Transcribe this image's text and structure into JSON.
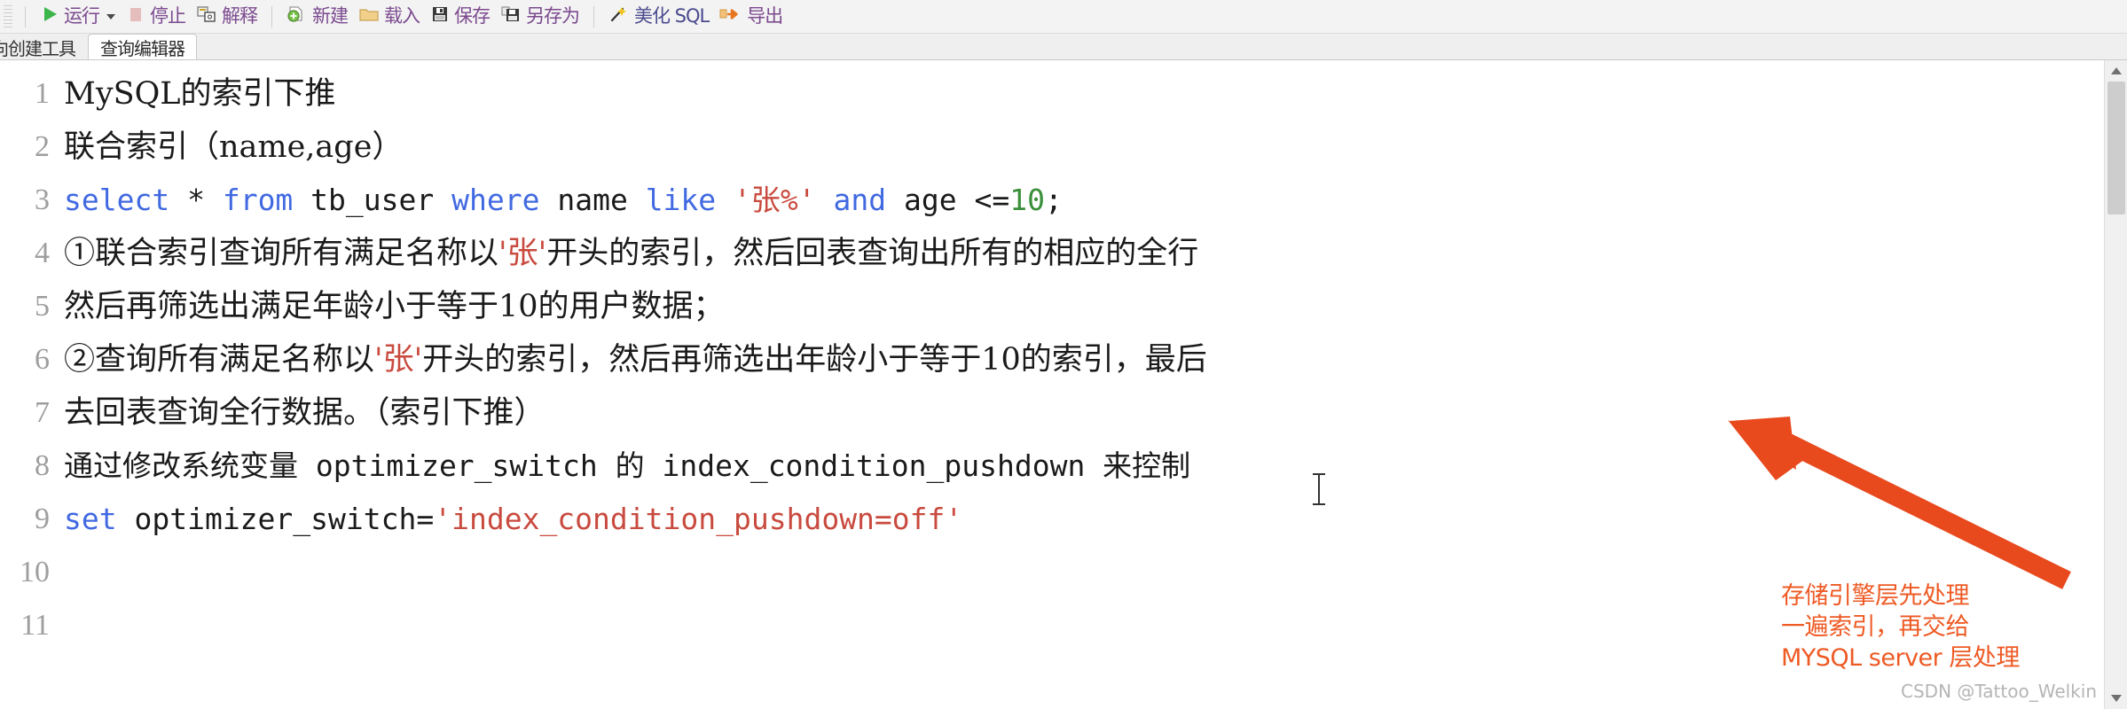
{
  "toolbar": {
    "buttons": [
      {
        "id": "run",
        "label": "运行",
        "icon": "play-icon",
        "has_caret": true
      },
      {
        "id": "stop",
        "label": "停止",
        "icon": "stop-icon",
        "has_caret": false
      },
      {
        "id": "explain",
        "label": "解释",
        "icon": "explain-icon",
        "has_caret": false
      },
      {
        "id": "new",
        "label": "新建",
        "icon": "new-file-icon",
        "has_caret": false
      },
      {
        "id": "load",
        "label": "载入",
        "icon": "folder-icon",
        "has_caret": false
      },
      {
        "id": "save",
        "label": "保存",
        "icon": "floppy-disk-icon",
        "has_caret": false
      },
      {
        "id": "save-as",
        "label": "另存为",
        "icon": "save-as-icon",
        "has_caret": false
      },
      {
        "id": "beautify",
        "label": "美化 SQL",
        "icon": "wand-icon",
        "has_caret": false
      },
      {
        "id": "export",
        "label": "导出",
        "icon": "export-arrow-icon",
        "has_caret": false
      }
    ]
  },
  "tabs": [
    {
      "id": "table-builder",
      "label": "向创建工具",
      "active": false
    },
    {
      "id": "query-editor",
      "label": "查询编辑器",
      "active": true
    }
  ],
  "editor": {
    "line_numbers": [
      "1",
      "2",
      "3",
      "4",
      "5",
      "6",
      "7",
      "8",
      "9",
      "10",
      "11"
    ],
    "lines": [
      {
        "n": 1,
        "mono": false,
        "tokens": [
          {
            "t": "MySQL的索引下推",
            "c": "plain"
          }
        ]
      },
      {
        "n": 2,
        "mono": false,
        "tokens": [
          {
            "t": "联合索引（name,age）",
            "c": "plain"
          }
        ]
      },
      {
        "n": 3,
        "mono": true,
        "tokens": [
          {
            "t": "select",
            "c": "kw"
          },
          {
            "t": " * ",
            "c": "plain"
          },
          {
            "t": "from",
            "c": "kw"
          },
          {
            "t": " tb_user ",
            "c": "plain"
          },
          {
            "t": "where",
            "c": "kw"
          },
          {
            "t": " name ",
            "c": "plain"
          },
          {
            "t": "like",
            "c": "kw"
          },
          {
            "t": " ",
            "c": "plain"
          },
          {
            "t": "'张%'",
            "c": "str"
          },
          {
            "t": " ",
            "c": "plain"
          },
          {
            "t": "and",
            "c": "kw"
          },
          {
            "t": " age <=",
            "c": "plain"
          },
          {
            "t": "10",
            "c": "num"
          },
          {
            "t": ";",
            "c": "plain"
          }
        ]
      },
      {
        "n": 4,
        "mono": false,
        "tokens": [
          {
            "t": "①联合索引查询所有满足名称以",
            "c": "plain"
          },
          {
            "t": "'张'",
            "c": "str"
          },
          {
            "t": "开头的索引，然后回表查询出所有的相应的全行",
            "c": "plain"
          }
        ]
      },
      {
        "n": 5,
        "mono": false,
        "tokens": [
          {
            "t": "然后再筛选出满足年龄小于等于10的用户数据；",
            "c": "plain"
          }
        ]
      },
      {
        "n": 6,
        "mono": false,
        "tokens": [
          {
            "t": "②查询所有满足名称以",
            "c": "plain"
          },
          {
            "t": "'张'",
            "c": "str"
          },
          {
            "t": "开头的索引，然后再筛选出年龄小于等于10的索引，最后",
            "c": "plain"
          }
        ]
      },
      {
        "n": 7,
        "mono": false,
        "tokens": [
          {
            "t": "去回表查询全行数据。（索引下推）",
            "c": "plain"
          }
        ]
      },
      {
        "n": 8,
        "mono": true,
        "tokens": [
          {
            "t": "通过修改系统变量 optimizer_switch 的 index_condition_pushdown 来控制",
            "c": "plain"
          }
        ]
      },
      {
        "n": 9,
        "mono": true,
        "tokens": [
          {
            "t": "set",
            "c": "kw"
          },
          {
            "t": " optimizer_switch=",
            "c": "plain"
          },
          {
            "t": "'index_condition_pushdown=off'",
            "c": "str"
          }
        ]
      },
      {
        "n": 10,
        "mono": false,
        "tokens": [
          {
            "t": "",
            "c": "plain"
          }
        ]
      },
      {
        "n": 11,
        "mono": false,
        "tokens": [
          {
            "t": "",
            "c": "plain"
          }
        ]
      }
    ]
  },
  "annotation": {
    "color": "#ee5a24",
    "lines": [
      "存储引擎层先处理",
      "一遍索引，再交给",
      "MYSQL server 层处理"
    ]
  },
  "watermark": {
    "text": "CSDN @Tattoo_Welkin"
  },
  "colors": {
    "keyword": "#4169e1",
    "string": "#c94a3e",
    "number": "#3a8f3a",
    "annotation": "#ee5a24",
    "toolbar_label": "#7b4a8f"
  }
}
